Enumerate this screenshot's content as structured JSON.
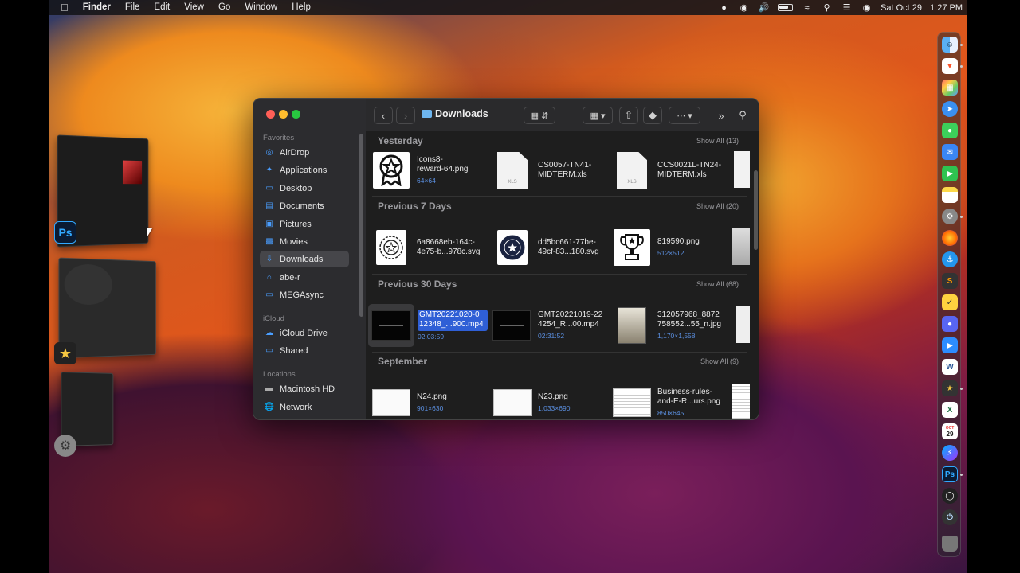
{
  "menubar": {
    "app_name": "Finder",
    "items": [
      "File",
      "Edit",
      "View",
      "Go",
      "Window",
      "Help"
    ],
    "datetime_date": "Sat Oct 29",
    "datetime_time": "1:27 PM"
  },
  "finder": {
    "location": "Downloads",
    "sidebar": {
      "favorites_header": "Favorites",
      "favorites": [
        {
          "label": "AirDrop",
          "icon": "airdrop-icon"
        },
        {
          "label": "Applications",
          "icon": "applications-icon"
        },
        {
          "label": "Desktop",
          "icon": "desktop-icon"
        },
        {
          "label": "Documents",
          "icon": "document-icon"
        },
        {
          "label": "Pictures",
          "icon": "pictures-icon"
        },
        {
          "label": "Movies",
          "icon": "movies-icon"
        },
        {
          "label": "Downloads",
          "icon": "downloads-icon",
          "selected": true
        },
        {
          "label": "abe-r",
          "icon": "home-icon"
        },
        {
          "label": "MEGAsync",
          "icon": "folder-icon"
        }
      ],
      "icloud_header": "iCloud",
      "icloud": [
        {
          "label": "iCloud Drive",
          "icon": "cloud-icon"
        },
        {
          "label": "Shared",
          "icon": "shared-folder-icon"
        }
      ],
      "locations_header": "Locations",
      "locations": [
        {
          "label": "Macintosh HD",
          "icon": "disk-icon"
        },
        {
          "label": "Network",
          "icon": "network-icon"
        }
      ]
    },
    "sections": [
      {
        "title": "Yesterday",
        "show_all": "Show All (13)",
        "files": [
          {
            "name_line1": "Icons8-",
            "name_line2": "reward-64.png",
            "meta": "64×64",
            "thumb": "badge-icon"
          },
          {
            "name_line1": "CS0057-TN41-",
            "name_line2": "MIDTERM.xls",
            "meta": "",
            "thumb": "xls"
          },
          {
            "name_line1": "CCS0021L-TN24-",
            "name_line2": "MIDTERM.xls",
            "meta": "",
            "thumb": "xls"
          }
        ]
      },
      {
        "title": "Previous 7 Days",
        "show_all": "Show All (20)",
        "files": [
          {
            "name_line1": "6a8668eb-164c-",
            "name_line2": "4e75-b...978c.svg",
            "meta": "",
            "thumb": "star-badge-outline"
          },
          {
            "name_line1": "dd5bc661-77be-",
            "name_line2": "49cf-83...180.svg",
            "meta": "",
            "thumb": "star-badge-filled"
          },
          {
            "name_line1": "819590.png",
            "name_line2": "",
            "meta": "512×512",
            "thumb": "trophy"
          }
        ]
      },
      {
        "title": "Previous 30 Days",
        "show_all": "Show All (68)",
        "files": [
          {
            "name_line1": "GMT20221020-0",
            "name_line2": "12348_...900.mp4",
            "meta": "02:03:59",
            "thumb": "video",
            "selected": true
          },
          {
            "name_line1": "GMT20221019-22",
            "name_line2": "4254_R...00.mp4",
            "meta": "02:31:52",
            "thumb": "video"
          },
          {
            "name_line1": "312057968_8872",
            "name_line2": "758552...55_n.jpg",
            "meta": "1,170×1,558",
            "thumb": "photo"
          }
        ]
      },
      {
        "title": "September",
        "show_all": "Show All (9)",
        "files": [
          {
            "name_line1": "N24.png",
            "name_line2": "",
            "meta": "901×630",
            "thumb": "screenshot"
          },
          {
            "name_line1": "N23.png",
            "name_line2": "",
            "meta": "1,033×690",
            "thumb": "screenshot"
          },
          {
            "name_line1": "Business-rules-",
            "name_line2": "and-E-R...urs.png",
            "meta": "850×645",
            "thumb": "document-scan"
          }
        ]
      }
    ]
  },
  "left_apps": {
    "photoshop_label": "Ps"
  },
  "dock": {
    "apps": [
      "Finder",
      "Brave",
      "Launchpad",
      "Safari",
      "Messages",
      "Mail",
      "FaceTime",
      "Notes",
      "System Preferences",
      "Firefox",
      "Docker",
      "Sublime",
      "Norton",
      "Discord",
      "Zoom",
      "Word",
      "iMovie",
      "Excel",
      "Calendar",
      "Messenger",
      "Photoshop",
      "OBS",
      "Power",
      "Trash"
    ],
    "calendar_day": "29",
    "calendar_month": "OCT",
    "photoshop_label": "Ps",
    "word_label": "W",
    "excel_label": "X"
  },
  "colors": {
    "accent": "#2f5fd6",
    "sidebar_bg": "#2c2c2f",
    "window_bg": "#1e1e1e"
  }
}
